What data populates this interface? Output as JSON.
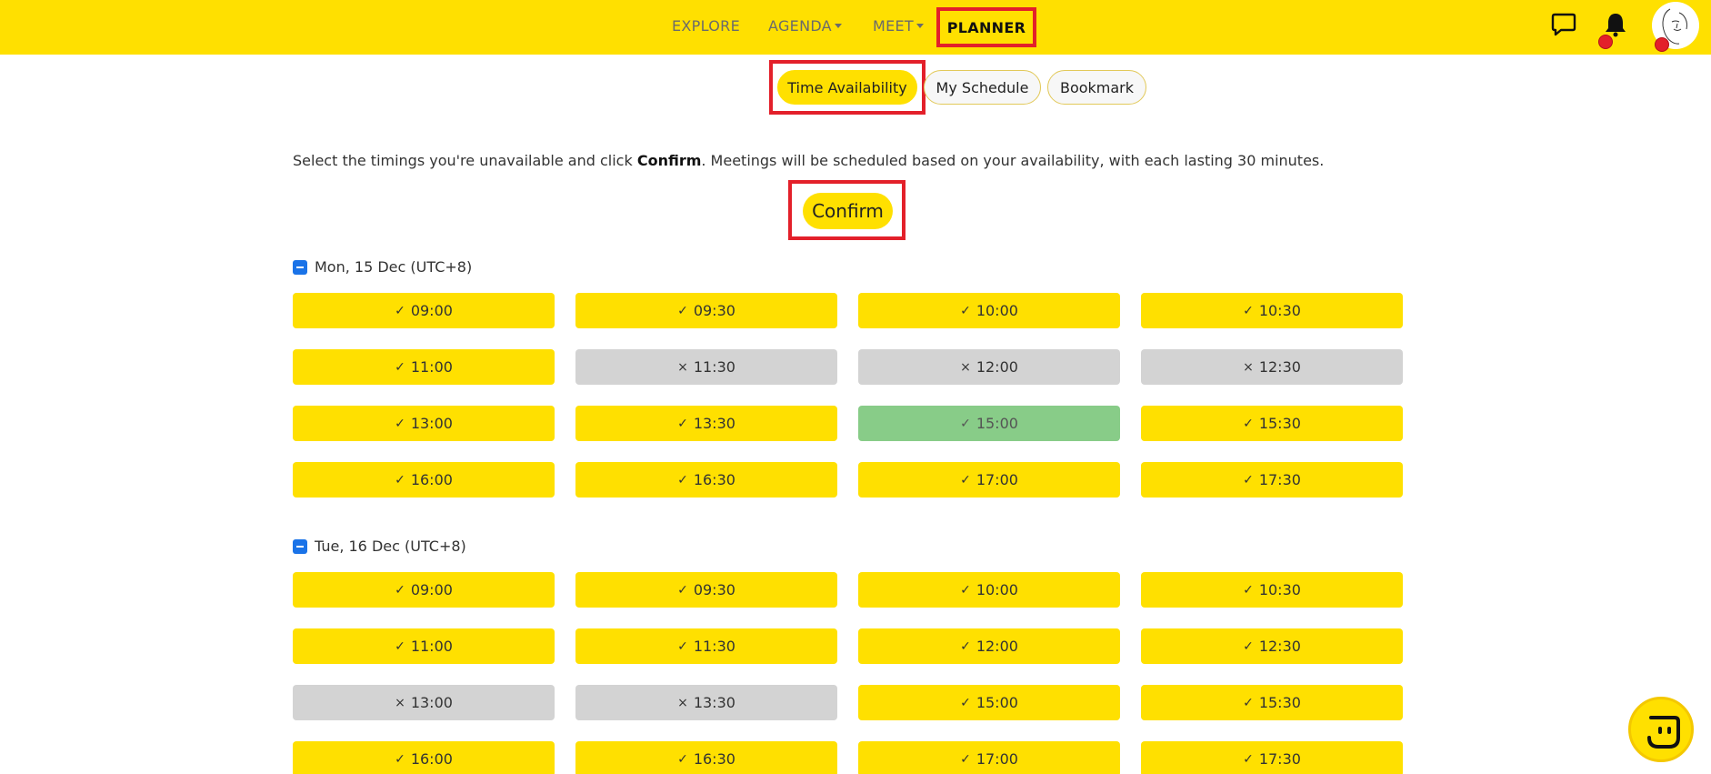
{
  "nav": {
    "explore": "EXPLORE",
    "agenda": "AGENDA",
    "meet": "MEET",
    "planner": "PLANNER"
  },
  "icons": {
    "chat": "chat-bubble-icon",
    "bell": "bell-icon",
    "avatar": "user-avatar",
    "assistant": "assistant-icon"
  },
  "subtabs": {
    "time": "Time Availability",
    "schedule": "My Schedule",
    "bookmark": "Bookmark"
  },
  "instructions": {
    "before": "Select the timings you're unavailable and click ",
    "bold": "Confirm",
    "after": ". Meetings will be scheduled based on your availability, with each lasting 30 minutes."
  },
  "confirm_label": "Confirm",
  "days": [
    {
      "label": "Mon, 15 Dec (UTC+8)",
      "slots": [
        {
          "time": "09:00",
          "state": "available"
        },
        {
          "time": "09:30",
          "state": "available"
        },
        {
          "time": "10:00",
          "state": "available"
        },
        {
          "time": "10:30",
          "state": "available"
        },
        {
          "time": "11:00",
          "state": "available"
        },
        {
          "time": "11:30",
          "state": "unavailable"
        },
        {
          "time": "12:00",
          "state": "unavailable"
        },
        {
          "time": "12:30",
          "state": "unavailable"
        },
        {
          "time": "13:00",
          "state": "available"
        },
        {
          "time": "13:30",
          "state": "available"
        },
        {
          "time": "15:00",
          "state": "selected"
        },
        {
          "time": "15:30",
          "state": "available"
        },
        {
          "time": "16:00",
          "state": "available"
        },
        {
          "time": "16:30",
          "state": "available"
        },
        {
          "time": "17:00",
          "state": "available"
        },
        {
          "time": "17:30",
          "state": "available"
        }
      ]
    },
    {
      "label": "Tue, 16 Dec (UTC+8)",
      "slots": [
        {
          "time": "09:00",
          "state": "available"
        },
        {
          "time": "09:30",
          "state": "available"
        },
        {
          "time": "10:00",
          "state": "available"
        },
        {
          "time": "10:30",
          "state": "available"
        },
        {
          "time": "11:00",
          "state": "available"
        },
        {
          "time": "11:30",
          "state": "available"
        },
        {
          "time": "12:00",
          "state": "available"
        },
        {
          "time": "12:30",
          "state": "available"
        },
        {
          "time": "13:00",
          "state": "unavailable"
        },
        {
          "time": "13:30",
          "state": "unavailable"
        },
        {
          "time": "15:00",
          "state": "available"
        },
        {
          "time": "15:30",
          "state": "available"
        },
        {
          "time": "16:00",
          "state": "available"
        },
        {
          "time": "16:30",
          "state": "available"
        },
        {
          "time": "17:00",
          "state": "available"
        },
        {
          "time": "17:30",
          "state": "available"
        }
      ]
    }
  ],
  "colors": {
    "brand_yellow": "#FFE000",
    "highlight_red": "#E3202A",
    "unavailable_gray": "#d3d3d3",
    "selected_green": "#88cc88",
    "checkbox_blue": "#1a73e8"
  }
}
